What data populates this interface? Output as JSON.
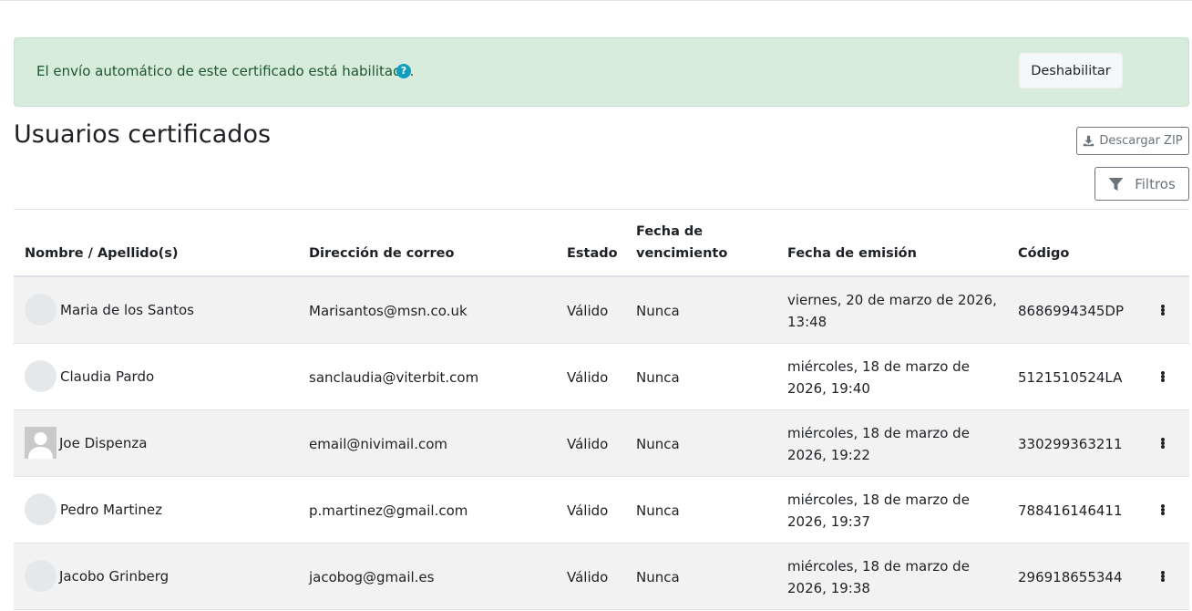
{
  "alert": {
    "message": "El envío automático de este certificado está habilitado.",
    "help_icon": "?",
    "disable_button": "Deshabilitar"
  },
  "page_title": "Usuarios certificados",
  "toolbar": {
    "download_zip": "Descargar ZIP",
    "filters": "Filtros"
  },
  "table": {
    "headers": {
      "name": "Nombre / Apellido(s)",
      "email": "Dirección de correo",
      "status": "Estado",
      "expiry_line1": "Fecha de",
      "expiry_line2": "vencimiento",
      "issued": "Fecha de emisión",
      "code": "Código"
    },
    "rows": [
      {
        "name": "Maria de los Santos",
        "email": "Marisantos@msn.co.uk",
        "status": "Válido",
        "expiry": "Nunca",
        "issued_line1": "viernes, 20 de marzo de 2026,",
        "issued_line2": "13:48",
        "code": "8686994345DP"
      },
      {
        "name": "Claudia Pardo",
        "email": "sanclaudia@viterbit.com",
        "status": "Válido",
        "expiry": "Nunca",
        "issued_line1": "miércoles, 18 de marzo de",
        "issued_line2": "2026, 19:40",
        "code": "5121510524LA"
      },
      {
        "name": "Joe Dispenza",
        "email": "email@nivimail.com",
        "status": "Válido",
        "expiry": "Nunca",
        "issued_line1": "miércoles, 18 de marzo de",
        "issued_line2": "2026, 19:22",
        "code": "330299363211"
      },
      {
        "name": "Pedro Martinez",
        "email": "p.martinez@gmail.com",
        "status": "Válido",
        "expiry": "Nunca",
        "issued_line1": "miércoles, 18 de marzo de",
        "issued_line2": "2026, 19:37",
        "code": "788416146411"
      },
      {
        "name": "Jacobo Grinberg",
        "email": "jacobog@gmail.es",
        "status": "Válido",
        "expiry": "Nunca",
        "issued_line1": "miércoles, 18 de marzo de",
        "issued_line2": "2026, 19:38",
        "code": "296918655344"
      }
    ]
  },
  "colors": {
    "alert_bg": "#d7ecdd",
    "alert_text": "#1c5630",
    "help_icon": "#0f9ebf",
    "row_stripe": "#f2f2f2"
  },
  "icons": {
    "help": "question-circle-icon",
    "download": "download-icon",
    "filter": "filter-icon",
    "row_menu": "kebab-menu-icon",
    "avatar": "user-avatar-icon"
  }
}
